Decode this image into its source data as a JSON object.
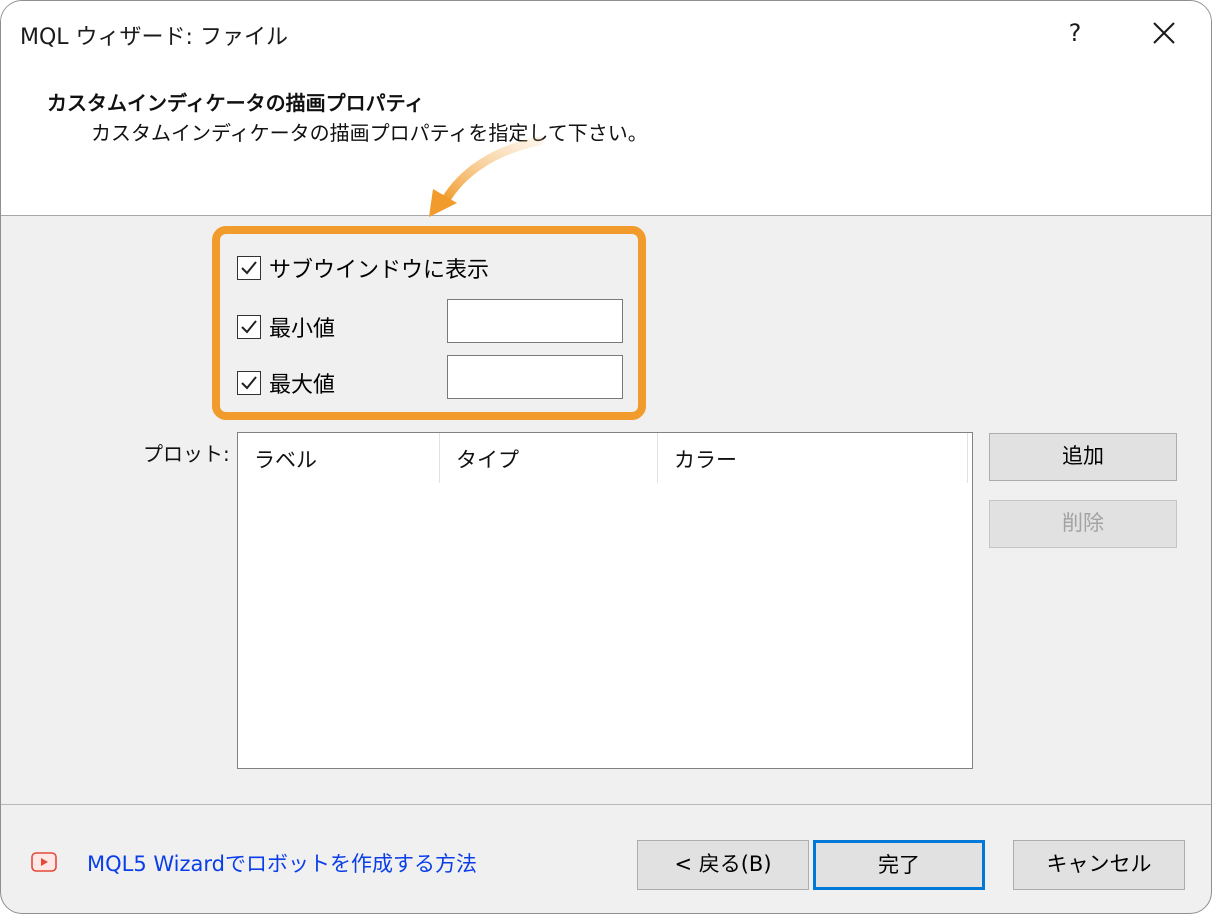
{
  "window": {
    "title": "MQL ウィザード: ファイル",
    "help_label": "?"
  },
  "header": {
    "title": "カスタムインディケータの描画プロパティ",
    "subtitle": "カスタムインディケータの描画プロパティを指定して下さい。"
  },
  "options": {
    "subwindow": {
      "label": "サブウインドウに表示",
      "checked": true
    },
    "minimum": {
      "label": "最小値",
      "checked": true,
      "value": ""
    },
    "maximum": {
      "label": "最大値",
      "checked": true,
      "value": ""
    }
  },
  "plots": {
    "label": "プロット:",
    "columns": [
      "ラベル",
      "タイプ",
      "カラー"
    ],
    "rows": []
  },
  "side_buttons": {
    "add": "追加",
    "delete": "削除"
  },
  "footer": {
    "link_text": "MQL5 Wizardでロボットを作成する方法",
    "back": "< 戻る(B)",
    "finish": "完了",
    "cancel": "キャンセル"
  },
  "colors": {
    "highlight": "#f19b2c",
    "link": "#0a3ee8",
    "default_button_border": "#0078d7"
  }
}
